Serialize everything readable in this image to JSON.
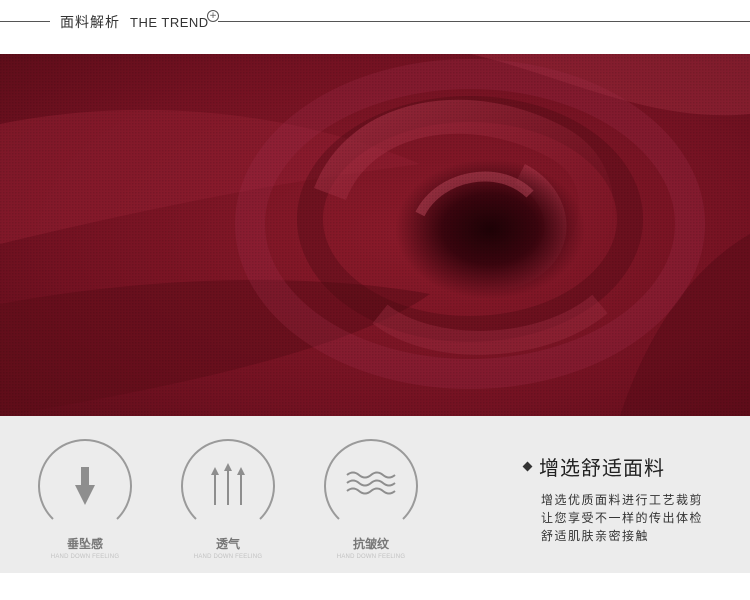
{
  "header": {
    "title_cn": "面料解析",
    "title_en": "THE TREND",
    "plus_symbol": "+"
  },
  "fabric_image": {
    "subject": "burgundy fabric swirl",
    "color": "#7a1424"
  },
  "features": [
    {
      "icon": "down-arrow-icon",
      "label": "垂坠感",
      "sublabel": "HAND DOWN FEELING"
    },
    {
      "icon": "up-arrows-icon",
      "label": "透气",
      "sublabel": "HAND DOWN FEELING"
    },
    {
      "icon": "waves-icon",
      "label": "抗皱纹",
      "sublabel": "HAND DOWN FEELING"
    }
  ],
  "description": {
    "title": "增选舒适面料",
    "lines": [
      "增选优质面料进行工艺裁剪",
      "让您享受不一样的传出体检",
      "舒适肌肤亲密接触"
    ]
  },
  "colors": {
    "panel_bg": "#ececec",
    "icon_gray": "#9a9a9a",
    "fabric": "#7a1424"
  }
}
